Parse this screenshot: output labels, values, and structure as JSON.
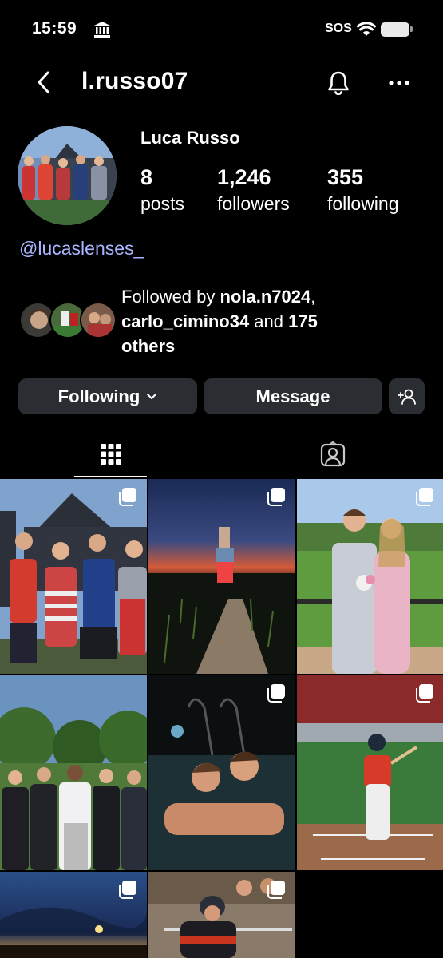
{
  "status_bar": {
    "time": "15:59",
    "carrier": "SOS"
  },
  "nav": {
    "username": "l.russo07"
  },
  "profile": {
    "display_name": "Luca Russo",
    "stats": [
      {
        "value": "8",
        "label": "posts"
      },
      {
        "value": "1,246",
        "label": "followers"
      },
      {
        "value": "355",
        "label": "following"
      }
    ],
    "link": "@lucaslenses_",
    "followed_by": {
      "prefix": "Followed by ",
      "user1": "nola.n7024",
      "sep": ",",
      "user2": "carlo_cimino34",
      "mid": " and ",
      "count": "175",
      "suffix": "others"
    }
  },
  "actions": {
    "following_label": "Following",
    "message_label": "Message"
  },
  "colors": {
    "background": "#000000",
    "button": "#2a2d31",
    "link": "#a8b5ff"
  }
}
